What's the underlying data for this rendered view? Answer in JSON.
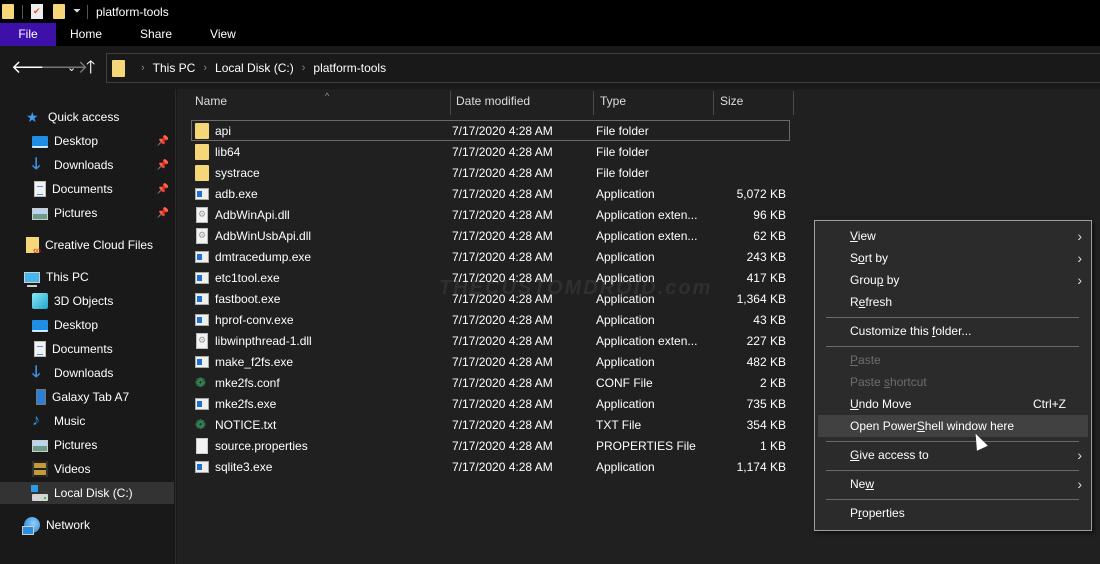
{
  "window": {
    "title": "platform-tools"
  },
  "ribbon": {
    "tabs": [
      "File",
      "Home",
      "Share",
      "View"
    ]
  },
  "navigation": {
    "breadcrumbs": [
      "This PC",
      "Local Disk (C:)",
      "platform-tools"
    ]
  },
  "sidebar": {
    "quick_access": {
      "label": "Quick access",
      "items": [
        {
          "label": "Desktop",
          "icon": "desktop-icon",
          "pinned": true
        },
        {
          "label": "Downloads",
          "icon": "downloads-icon",
          "pinned": true
        },
        {
          "label": "Documents",
          "icon": "documents-icon",
          "pinned": true
        },
        {
          "label": "Pictures",
          "icon": "pictures-icon",
          "pinned": true
        }
      ]
    },
    "creative_cloud": {
      "label": "Creative Cloud Files"
    },
    "this_pc": {
      "label": "This PC",
      "items": [
        {
          "label": "3D Objects",
          "icon": "3d-objects-icon"
        },
        {
          "label": "Desktop",
          "icon": "desktop-icon"
        },
        {
          "label": "Documents",
          "icon": "documents-icon"
        },
        {
          "label": "Downloads",
          "icon": "downloads-icon"
        },
        {
          "label": "Galaxy Tab A7",
          "icon": "tablet-icon"
        },
        {
          "label": "Music",
          "icon": "music-icon"
        },
        {
          "label": "Pictures",
          "icon": "pictures-icon"
        },
        {
          "label": "Videos",
          "icon": "videos-icon"
        },
        {
          "label": "Local Disk (C:)",
          "icon": "disk-icon",
          "selected": true
        }
      ]
    },
    "network": {
      "label": "Network"
    }
  },
  "filelist": {
    "columns": {
      "name": "Name",
      "date": "Date modified",
      "type": "Type",
      "size": "Size"
    },
    "sort_column": "Name",
    "files": [
      {
        "name": "api",
        "date": "7/17/2020 4:28 AM",
        "type": "File folder",
        "size": "",
        "icon": "folder"
      },
      {
        "name": "lib64",
        "date": "7/17/2020 4:28 AM",
        "type": "File folder",
        "size": "",
        "icon": "folder"
      },
      {
        "name": "systrace",
        "date": "7/17/2020 4:28 AM",
        "type": "File folder",
        "size": "",
        "icon": "folder"
      },
      {
        "name": "adb.exe",
        "date": "7/17/2020 4:28 AM",
        "type": "Application",
        "size": "5,072 KB",
        "icon": "exe"
      },
      {
        "name": "AdbWinApi.dll",
        "date": "7/17/2020 4:28 AM",
        "type": "Application exten...",
        "size": "96 KB",
        "icon": "dll"
      },
      {
        "name": "AdbWinUsbApi.dll",
        "date": "7/17/2020 4:28 AM",
        "type": "Application exten...",
        "size": "62 KB",
        "icon": "dll"
      },
      {
        "name": "dmtracedump.exe",
        "date": "7/17/2020 4:28 AM",
        "type": "Application",
        "size": "243 KB",
        "icon": "exe"
      },
      {
        "name": "etc1tool.exe",
        "date": "7/17/2020 4:28 AM",
        "type": "Application",
        "size": "417 KB",
        "icon": "exe"
      },
      {
        "name": "fastboot.exe",
        "date": "7/17/2020 4:28 AM",
        "type": "Application",
        "size": "1,364 KB",
        "icon": "exe"
      },
      {
        "name": "hprof-conv.exe",
        "date": "7/17/2020 4:28 AM",
        "type": "Application",
        "size": "43 KB",
        "icon": "exe"
      },
      {
        "name": "libwinpthread-1.dll",
        "date": "7/17/2020 4:28 AM",
        "type": "Application exten...",
        "size": "227 KB",
        "icon": "dll"
      },
      {
        "name": "make_f2fs.exe",
        "date": "7/17/2020 4:28 AM",
        "type": "Application",
        "size": "482 KB",
        "icon": "exe"
      },
      {
        "name": "mke2fs.conf",
        "date": "7/17/2020 4:28 AM",
        "type": "CONF File",
        "size": "2 KB",
        "icon": "conf"
      },
      {
        "name": "mke2fs.exe",
        "date": "7/17/2020 4:28 AM",
        "type": "Application",
        "size": "735 KB",
        "icon": "exe"
      },
      {
        "name": "NOTICE.txt",
        "date": "7/17/2020 4:28 AM",
        "type": "TXT File",
        "size": "354 KB",
        "icon": "conf"
      },
      {
        "name": "source.properties",
        "date": "7/17/2020 4:28 AM",
        "type": "PROPERTIES File",
        "size": "1 KB",
        "icon": "blank"
      },
      {
        "name": "sqlite3.exe",
        "date": "7/17/2020 4:28 AM",
        "type": "Application",
        "size": "1,174 KB",
        "icon": "exe"
      }
    ],
    "watermark": "THECUSTOMDROID.com"
  },
  "context_menu": {
    "items": [
      {
        "pre": "",
        "key": "V",
        "post": "iew",
        "submenu": true
      },
      {
        "pre": "S",
        "key": "o",
        "post": "rt by",
        "submenu": true
      },
      {
        "pre": "Grou",
        "key": "p",
        "post": " by",
        "submenu": true
      },
      {
        "pre": "R",
        "key": "e",
        "post": "fresh"
      },
      {
        "pre": "Customize this ",
        "key": "f",
        "post": "older..."
      },
      {
        "pre": "",
        "key": "P",
        "post": "aste",
        "disabled": true
      },
      {
        "pre": "Paste ",
        "key": "s",
        "post": "hortcut",
        "disabled": true
      },
      {
        "pre": "",
        "key": "U",
        "post": "ndo Move",
        "shortcut": "Ctrl+Z"
      },
      {
        "pre": "Open Power",
        "key": "S",
        "post": "hell window here",
        "hover": true
      },
      {
        "pre": "",
        "key": "G",
        "post": "ive access to",
        "submenu": true
      },
      {
        "pre": "Ne",
        "key": "w",
        "post": "",
        "submenu": true
      },
      {
        "pre": "P",
        "key": "r",
        "post": "operties"
      }
    ]
  },
  "colors": {
    "file_tab": "#3d10aa",
    "background": "#191919",
    "list_background": "#202020",
    "menu_background": "#2b2b2b",
    "folder": "#f5d77a"
  }
}
